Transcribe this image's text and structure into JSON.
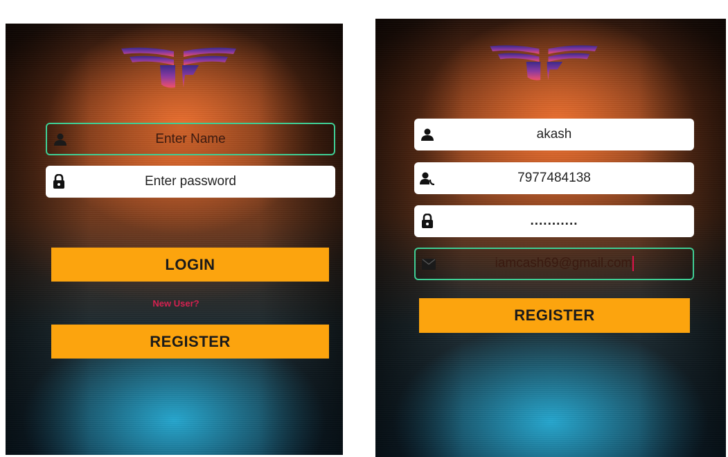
{
  "login_screen": {
    "name_field": {
      "placeholder": "Enter Name"
    },
    "password_field": {
      "placeholder": "Enter password"
    },
    "login_button": "LOGIN",
    "new_user_link": "New User?",
    "register_button": "REGISTER"
  },
  "register_screen": {
    "name_field": {
      "value": "akash"
    },
    "phone_field": {
      "value": "7977484138"
    },
    "password_field": {
      "value": "..........."
    },
    "email_field": {
      "value": "iamcash69@gmail.com"
    },
    "register_button": "REGISTER"
  },
  "colors": {
    "button": "#fca40e",
    "focus_border": "#3fcf95",
    "link": "#d42150"
  },
  "icons": [
    "logo",
    "person-icon",
    "lock-icon",
    "phone-person-icon",
    "email-icon"
  ]
}
